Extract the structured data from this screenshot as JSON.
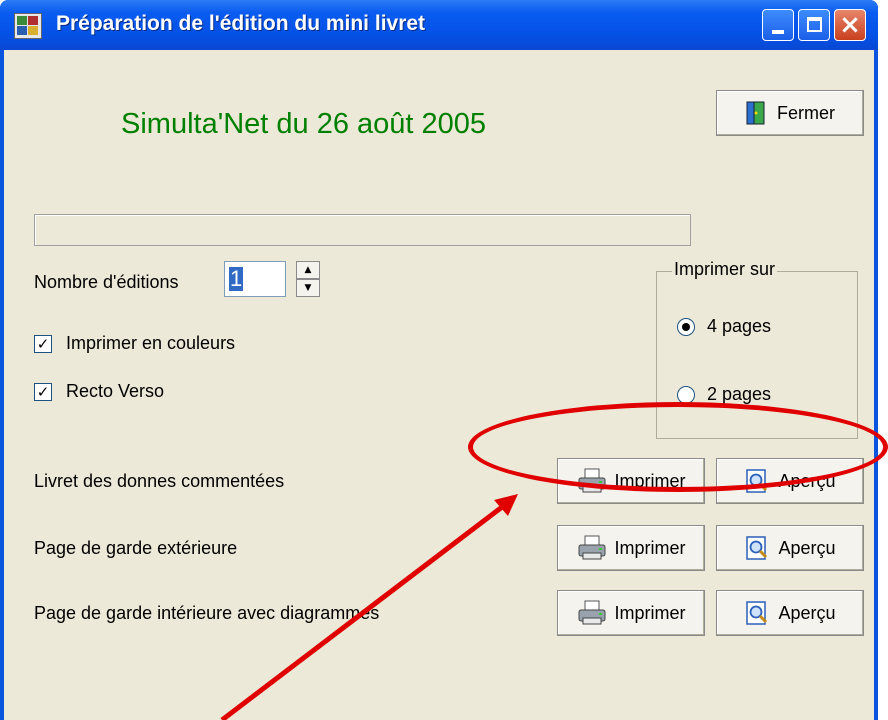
{
  "window": {
    "title": "Préparation de l'édition du mini livret"
  },
  "heading": "Simulta'Net du 26 août 2005",
  "close_button": "Fermer",
  "editions": {
    "label": "Nombre d'éditions",
    "value": "1"
  },
  "options": {
    "color_label": "Imprimer en couleurs",
    "color_checked": true,
    "duplex_label": "Recto Verso",
    "duplex_checked": true
  },
  "print_on": {
    "label": "Imprimer sur",
    "option_4": "4 pages",
    "option_2": "2 pages",
    "selected": "4 pages"
  },
  "rows": [
    {
      "label": "Livret des donnes commentées",
      "print": "Imprimer",
      "preview": "Aperçu"
    },
    {
      "label": "Page de garde extérieure",
      "print": "Imprimer",
      "preview": "Aperçu"
    },
    {
      "label": "Page de garde intérieure avec diagrammes",
      "print": "Imprimer",
      "preview": "Aperçu"
    }
  ],
  "icons": {
    "app": "app-icon",
    "close_door": "door-exit-icon",
    "print": "printer-icon",
    "preview": "magnifier-page-icon"
  },
  "colors": {
    "titlebar": "#0a5cf0",
    "client_bg": "#ece9d8",
    "heading": "#008000",
    "annotation": "#e00000"
  }
}
